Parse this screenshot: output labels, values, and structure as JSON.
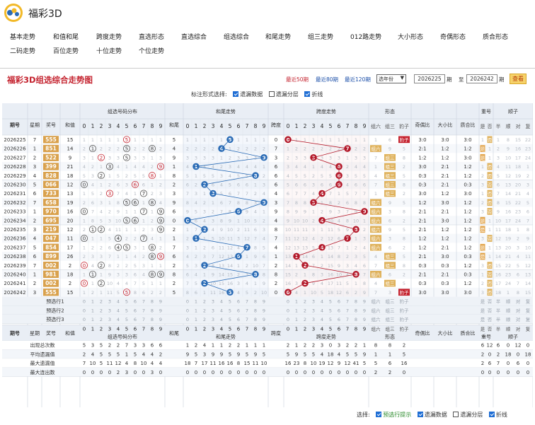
{
  "app": {
    "name": "福彩3D"
  },
  "nav": {
    "items": [
      "基本走势",
      "和值和尾",
      "跨度走势",
      "直选形态",
      "直选综合",
      "组选综合",
      "和尾走势",
      "组三走势",
      "012路走势",
      "大小形态",
      "奇偶形态",
      "质合形态",
      "二码走势",
      "百位走势",
      "十位走势",
      "个位走势"
    ]
  },
  "panel": {
    "title": "福彩3D组选综合走势图",
    "recent50": "最近50期",
    "recent80": "最近80期",
    "recent120": "最近120期",
    "select_year": "选年份",
    "from_value": "2026225",
    "to_label": "至",
    "to_value": "2026242",
    "period_label": "期",
    "query": "查看"
  },
  "mark": {
    "label": "标注形式选择:",
    "omission": "遗漏数据",
    "layer": "遗漏分层",
    "line": "折线"
  },
  "headers": {
    "period": "期号",
    "star": "星期",
    "award": "奖号",
    "sum": "和值",
    "dist": "组选号码分布",
    "tail": "和尾",
    "tail_trend": "和尾走势",
    "span": "跨度",
    "span_trend": "跨度走势",
    "form": "形态",
    "odd_even": "奇偶比",
    "big_small": "大小比",
    "prime_comp": "质合比",
    "repeat": "重号",
    "order": "顺子",
    "zu6": "组六",
    "zu3": "组三",
    "baozi": "豹子",
    "yes": "是",
    "no": "否",
    "half": "半",
    "shun": "顺",
    "dui": "对",
    "fu": "复",
    "order_bottom": "顺子"
  },
  "rows": [
    {
      "p": "2026225",
      "w": "7",
      "a": "555",
      "s": "15",
      "t": "5",
      "sp": "0",
      "oe": "3:0",
      "bs": "3:0",
      "pc": "3:0"
    },
    {
      "p": "2026226",
      "w": "1",
      "a": "851",
      "s": "14",
      "t": "4",
      "sp": "7",
      "oe": "2:1",
      "bs": "1:2",
      "pc": "1:2"
    },
    {
      "p": "2026227",
      "w": "2",
      "a": "522",
      "s": "9",
      "t": "9",
      "sp": "3",
      "oe": "1:2",
      "bs": "1:2",
      "pc": "3:0"
    },
    {
      "p": "2026228",
      "w": "3",
      "a": "399",
      "s": "21",
      "t": "1",
      "sp": "6",
      "oe": "3:0",
      "bs": "2:1",
      "pc": "1:2"
    },
    {
      "p": "2026229",
      "w": "4",
      "a": "828",
      "s": "18",
      "t": "8",
      "sp": "6",
      "oe": "0:3",
      "bs": "2:1",
      "pc": "1:2"
    },
    {
      "p": "2026230",
      "w": "5",
      "a": "066",
      "s": "12",
      "t": "2",
      "sp": "6",
      "oe": "0:3",
      "bs": "2:1",
      "pc": "0:3"
    },
    {
      "p": "2026231",
      "w": "6",
      "a": "733",
      "s": "13",
      "t": "3",
      "sp": "4",
      "oe": "3:0",
      "bs": "1:2",
      "pc": "3:0"
    },
    {
      "p": "2026232",
      "w": "7",
      "a": "658",
      "s": "19",
      "t": "9",
      "sp": "3",
      "oe": "1:2",
      "bs": "3:0",
      "pc": "1:2"
    },
    {
      "p": "2026233",
      "w": "1",
      "a": "970",
      "s": "16",
      "t": "6",
      "sp": "9",
      "oe": "2:1",
      "bs": "2:1",
      "pc": "1:2"
    },
    {
      "p": "2026234",
      "w": "2",
      "a": "695",
      "s": "20",
      "t": "0",
      "sp": "4",
      "oe": "2:1",
      "bs": "3:0",
      "pc": "1:2"
    },
    {
      "p": "2026235",
      "w": "3",
      "a": "219",
      "s": "12",
      "t": "2",
      "sp": "8",
      "oe": "2:1",
      "bs": "1:2",
      "pc": "1:2"
    },
    {
      "p": "2026236",
      "w": "4",
      "a": "047",
      "s": "11",
      "t": "1",
      "sp": "7",
      "oe": "1:2",
      "bs": "1:2",
      "pc": "1:2"
    },
    {
      "p": "2026237",
      "w": "5",
      "a": "854",
      "s": "17",
      "t": "7",
      "sp": "4",
      "oe": "1:2",
      "bs": "2:1",
      "pc": "1:2"
    },
    {
      "p": "2026238",
      "w": "6",
      "a": "899",
      "s": "26",
      "t": "6",
      "sp": "1",
      "oe": "2:1",
      "bs": "3:0",
      "pc": "0:3"
    },
    {
      "p": "2026239",
      "w": "7",
      "a": "002",
      "s": "2",
      "t": "2",
      "sp": "2",
      "oe": "0:3",
      "bs": "0:3",
      "pc": "1:2"
    },
    {
      "p": "2026240",
      "w": "1",
      "a": "981",
      "s": "18",
      "t": "8",
      "sp": "8",
      "oe": "2:1",
      "bs": "2:1",
      "pc": "0:3"
    },
    {
      "p": "2026241",
      "w": "2",
      "a": "002",
      "s": "2",
      "t": "2",
      "sp": "2",
      "oe": "0:3",
      "bs": "0:3",
      "pc": "1:2"
    },
    {
      "p": "2026242",
      "w": "3",
      "a": "555",
      "s": "15",
      "t": "5",
      "sp": "0",
      "oe": "3:0",
      "bs": "3:0",
      "pc": "3:0"
    }
  ],
  "preview": [
    "预选行1",
    "预选行2",
    "预选行3"
  ],
  "stats": [
    {
      "label": "出现总次数",
      "dist": [
        "5",
        "3",
        "5",
        "2",
        "2",
        "7",
        "3",
        "3",
        "6",
        "6"
      ],
      "tail": [
        "1",
        "2",
        "4",
        "1",
        "1",
        "2",
        "2",
        "1",
        "1",
        "1"
      ],
      "span": [
        "2",
        "1",
        "2",
        "2",
        "3",
        "0",
        "3",
        "2",
        "2",
        "1"
      ],
      "form": [
        "8",
        "8",
        "2"
      ],
      "right": [
        "6",
        "12",
        "6",
        "0",
        "12",
        "0"
      ]
    },
    {
      "label": "平均遗漏值",
      "dist": [
        "2",
        "4",
        "5",
        "5",
        "5",
        "1",
        "5",
        "4",
        "4",
        "2"
      ],
      "tail": [
        "9",
        "5",
        "3",
        "9",
        "9",
        "5",
        "9",
        "5",
        "9",
        "5"
      ],
      "span": [
        "5",
        "9",
        "5",
        "5",
        "4",
        "18",
        "4",
        "5",
        "5",
        "9"
      ],
      "form": [
        "1",
        "1",
        "5"
      ],
      "right": [
        "2",
        "0",
        "2",
        "18",
        "0",
        "18"
      ]
    },
    {
      "label": "最大遗漏值",
      "dist": [
        "7",
        "10",
        "5",
        "11",
        "12",
        "4",
        "8",
        "10",
        "4",
        "4"
      ],
      "tail": [
        "18",
        "7",
        "17",
        "11",
        "16",
        "16",
        "8",
        "15",
        "11",
        "10"
      ],
      "span": [
        "16",
        "23",
        "8",
        "10",
        "19",
        "12",
        "9",
        "12",
        "41",
        "5"
      ],
      "form": [
        "5",
        "6",
        "16"
      ],
      "right": [
        "2",
        "6",
        "7",
        "0",
        "6",
        "0"
      ]
    },
    {
      "label": "最大连出数",
      "dist": [
        "0",
        "0",
        "0",
        "0",
        "2",
        "3",
        "0",
        "0",
        "3",
        "0"
      ],
      "tail": [
        "0",
        "0",
        "0",
        "0",
        "0",
        "0",
        "0",
        "0",
        "0",
        "0"
      ],
      "span": [
        "0",
        "0",
        "0",
        "0",
        "0",
        "0",
        "0",
        "0",
        "0",
        "0"
      ],
      "form": [
        "2",
        "2",
        "0"
      ],
      "right": [
        "0",
        "0",
        "0",
        "0",
        "0",
        "0"
      ]
    }
  ],
  "footer": {
    "label": "选择:",
    "preview": "预选行提示",
    "omission": "遗漏数据",
    "layer": "遗漏分层",
    "line": "折线"
  },
  "digits": [
    "0",
    "1",
    "2",
    "3",
    "4",
    "5",
    "6",
    "7",
    "8",
    "9"
  ],
  "colors": {
    "title_red": "#c4222e",
    "award_gold": "#d9a14c",
    "blue_ball": "#2a6bb5",
    "red_ball": "#b3192a",
    "link_blue": "#1a4ea8"
  }
}
